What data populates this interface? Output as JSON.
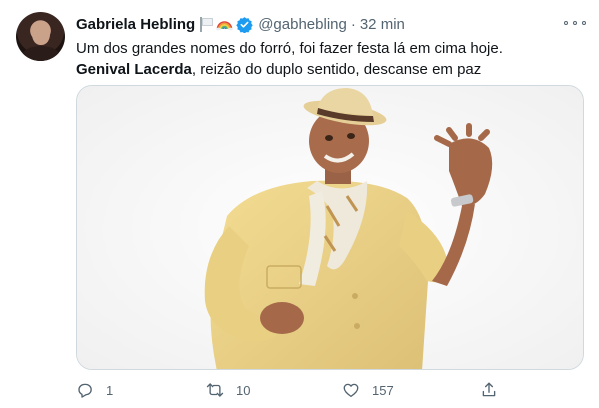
{
  "tweet": {
    "author": {
      "name": "Gabriela Hebling",
      "handle": "@gabhebling",
      "separator": "·",
      "time": "32 min"
    },
    "text": {
      "line1": "Um dos grandes nomes do forró, foi fazer festa lá em cima hoje.",
      "line2_bold": "Genival Lacerda",
      "line2_rest": ", reizão do duplo sentido, descanse em paz"
    },
    "stats": {
      "replies": "1",
      "retweets": "10",
      "likes": "157"
    }
  },
  "icons": {
    "flag": "white-flag-icon",
    "rainbow": "rainbow-icon",
    "verified": "verified-badge-icon",
    "more": "more-options-icon",
    "reply": "reply-icon",
    "retweet": "retweet-icon",
    "like": "heart-icon",
    "share": "share-icon"
  },
  "colors": {
    "text_primary": "#0f1419",
    "text_secondary": "#536471",
    "verified_blue": "#1d9bf0",
    "border": "#cfd9de"
  }
}
